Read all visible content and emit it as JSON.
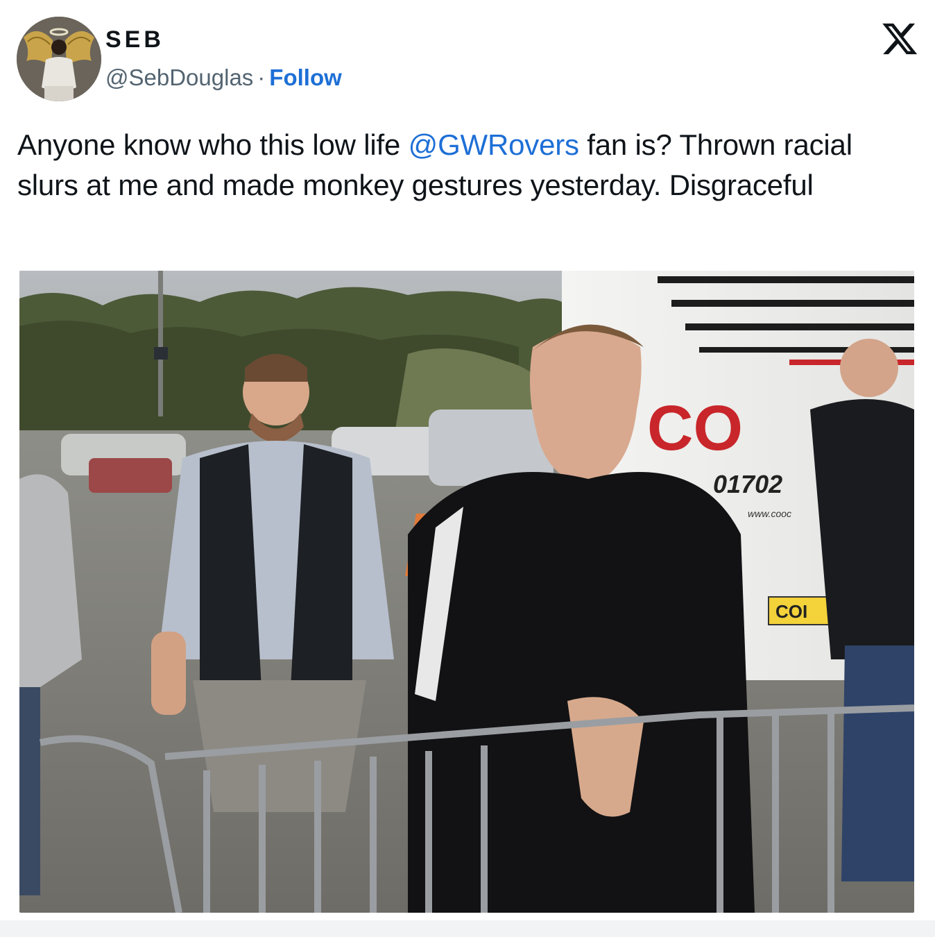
{
  "author": {
    "display_name": "SEB",
    "handle": "@SebDouglas",
    "separator": "·",
    "follow_label": "Follow",
    "avatar_icon": "profile-avatar-icon"
  },
  "platform_icon": "x-logo-icon",
  "tweet": {
    "text_before_mention": "Anyone know who this low life ",
    "mention": "@GWRovers",
    "text_after_mention": " fan is? Thrown racial slurs at me and made monkey gestures yesterday. Disgraceful"
  },
  "media": {
    "coach_livery_text": "CO",
    "coach_phone_text": "01702",
    "coach_web_text": "www.cooc",
    "plate_text": "COI"
  },
  "colors": {
    "link_blue": "#1d6fd6",
    "text_primary": "#0f1419",
    "text_secondary": "#536471",
    "livery_red": "#c8262a"
  }
}
